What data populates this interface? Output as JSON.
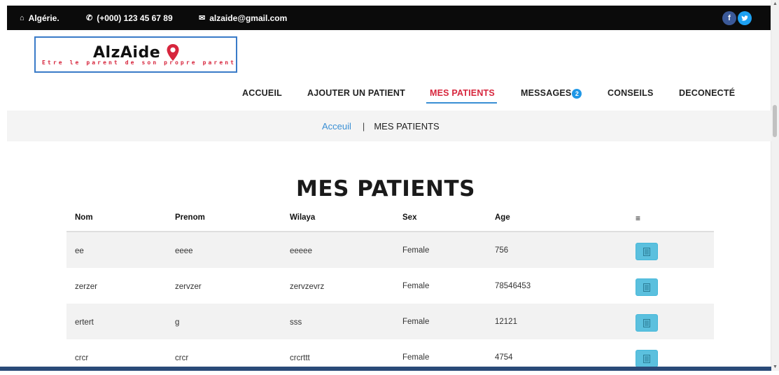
{
  "topbar": {
    "location": "Algérie.",
    "phone": "(+000) 123 45 67 89",
    "email": "alzaide@gmail.com",
    "social": [
      {
        "icon": "facebook-icon",
        "glyph": "f",
        "color": "#3b5998"
      },
      {
        "icon": "twitter-icon",
        "glyph": "t",
        "color": "#1da1f2"
      }
    ]
  },
  "logo": {
    "name": "AlzAide",
    "tagline": "Etre le parent de son propre parent",
    "pin_color": "#d7263d"
  },
  "nav": {
    "items": [
      {
        "label": "ACCUEIL"
      },
      {
        "label": "AJOUTER UN PATIENT"
      },
      {
        "label": "MES PATIENTS",
        "active": true
      },
      {
        "label": "MESSAGES",
        "badge": "2"
      },
      {
        "label": "CONSEILS"
      },
      {
        "label": "DECONECTÉ"
      }
    ]
  },
  "breadcrumb": {
    "home": "Acceuil",
    "separator": "|",
    "current": "MES PATIENTS"
  },
  "page_title": "MES PATIENTS",
  "table": {
    "headers": [
      "Nom",
      "Prenom",
      "Wilaya",
      "Sex",
      "Age",
      "≡"
    ],
    "rows": [
      {
        "nom": "ee",
        "prenom": "eeee",
        "wilaya": "eeeee",
        "sex": "Female",
        "age": "756"
      },
      {
        "nom": "zerzer",
        "prenom": "zervzer",
        "wilaya": "zervzevrz",
        "sex": "Female",
        "age": "78546453"
      },
      {
        "nom": "ertert",
        "prenom": "g",
        "wilaya": "sss",
        "sex": "Female",
        "age": "12121"
      },
      {
        "nom": "crcr",
        "prenom": "crcr",
        "wilaya": "crcrttt",
        "sex": "Female",
        "age": "4754"
      }
    ]
  },
  "colors": {
    "accent_red": "#d7263d",
    "link_blue": "#3a8fd4",
    "button_cyan": "#5bc0de",
    "topbar_bg": "#0b0b0b"
  }
}
